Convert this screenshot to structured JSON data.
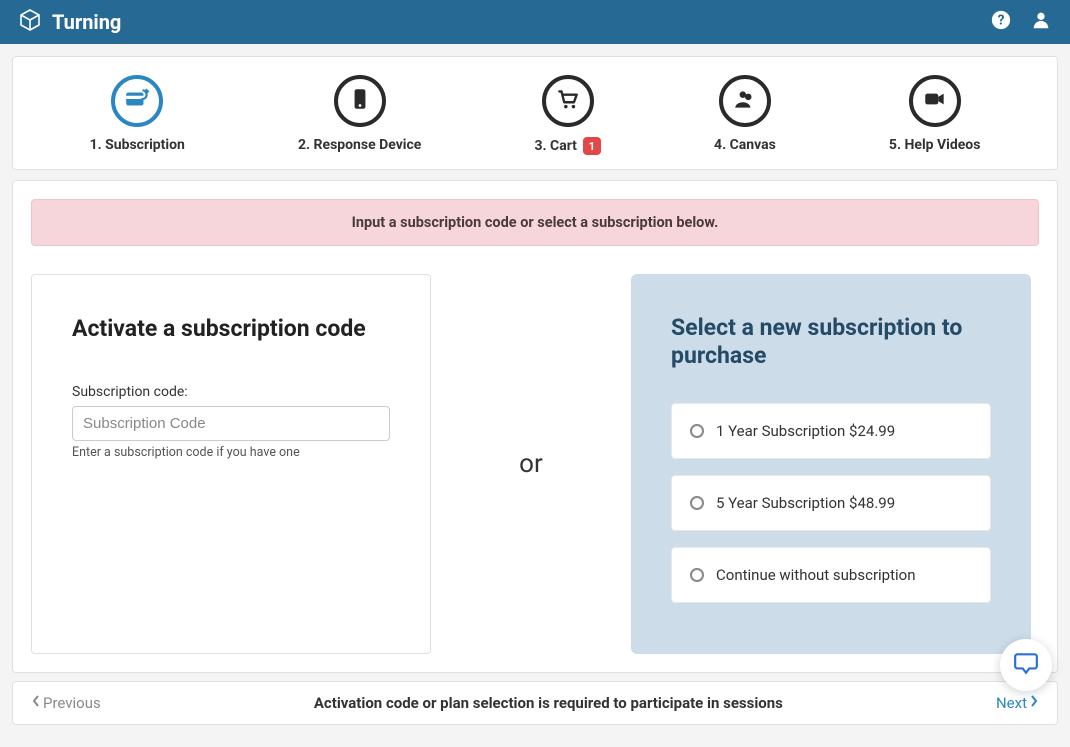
{
  "header": {
    "brand": "Turning"
  },
  "steps": [
    {
      "label": "1. Subscription",
      "active": true,
      "badge": null
    },
    {
      "label": "2. Response Device",
      "active": false,
      "badge": null
    },
    {
      "label": "3. Cart",
      "active": false,
      "badge": "1"
    },
    {
      "label": "4. Canvas",
      "active": false,
      "badge": null
    },
    {
      "label": "5. Help Videos",
      "active": false,
      "badge": null
    }
  ],
  "alert": "Input a subscription code or select a subscription below.",
  "activate": {
    "title": "Activate a subscription code",
    "field_label": "Subscription code:",
    "placeholder": "Subscription Code",
    "hint": "Enter a subscription code if you have one"
  },
  "or_label": "or",
  "purchase": {
    "title": "Select a new subscription to purchase",
    "options": [
      "1 Year Subscription $24.99",
      "5 Year Subscription $48.99",
      "Continue without subscription"
    ]
  },
  "footer": {
    "prev": "Previous",
    "message": "Activation code or plan selection is required to participate in sessions",
    "next": "Next"
  }
}
